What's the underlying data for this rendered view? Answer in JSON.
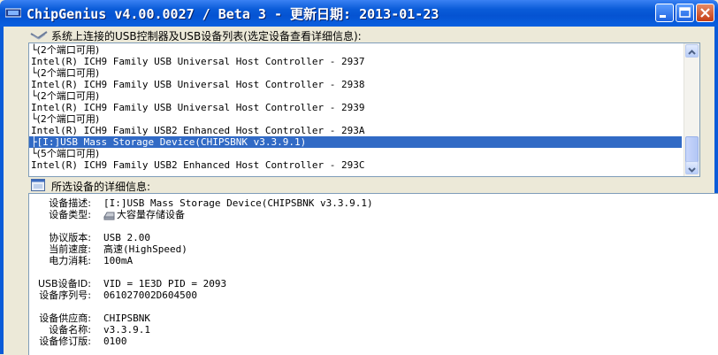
{
  "window": {
    "title": "ChipGenius v4.00.0027 / Beta 3 - 更新日期: 2013-01-23"
  },
  "device_list": {
    "label": "系统上连接的USB控制器及USB设备列表(选定设备查看详细信息):",
    "rows": [
      {
        "text": "└(2个端口可用)",
        "kind": "sub"
      },
      {
        "text": "Intel(R) ICH9 Family USB Universal Host Controller - 2937",
        "kind": "controller"
      },
      {
        "text": "└(2个端口可用)",
        "kind": "sub"
      },
      {
        "text": "Intel(R) ICH9 Family USB Universal Host Controller - 2938",
        "kind": "controller"
      },
      {
        "text": "└(2个端口可用)",
        "kind": "sub"
      },
      {
        "text": "Intel(R) ICH9 Family USB Universal Host Controller - 2939",
        "kind": "controller"
      },
      {
        "text": "└(2个端口可用)",
        "kind": "sub"
      },
      {
        "text": "Intel(R) ICH9 Family USB2 Enhanced Host Controller - 293A",
        "kind": "controller"
      },
      {
        "text": "├[I:]USB Mass Storage Device(CHIPSBNK v3.3.9.1)",
        "kind": "device",
        "selected": true
      },
      {
        "text": "└(5个端口可用)",
        "kind": "sub"
      },
      {
        "text": "Intel(R) ICH9 Family USB2 Enhanced Host Controller - 293C",
        "kind": "controller"
      }
    ]
  },
  "details": {
    "label": "所选设备的详细信息:",
    "rows": [
      {
        "label": "设备描述:",
        "value": "[I:]USB Mass Storage Device(CHIPSBNK v3.3.9.1)"
      },
      {
        "label": "设备类型:",
        "value": "大容量存储设备",
        "icon": "storage-device-icon"
      },
      {
        "label": "",
        "value": ""
      },
      {
        "label": "协议版本:",
        "value": "USB 2.00"
      },
      {
        "label": "当前速度:",
        "value": "高速(HighSpeed)"
      },
      {
        "label": "电力消耗:",
        "value": "100mA"
      },
      {
        "label": "",
        "value": ""
      },
      {
        "label": "USB设备ID:",
        "value": "VID = 1E3D PID = 2093"
      },
      {
        "label": "设备序列号:",
        "value": "061027002D604500"
      },
      {
        "label": "",
        "value": ""
      },
      {
        "label": "设备供应商:",
        "value": "CHIPSBNK"
      },
      {
        "label": "设备名称:",
        "value": "v3.3.9.1"
      },
      {
        "label": "设备修订版:",
        "value": "0100"
      }
    ]
  },
  "colors": {
    "title_bar": "#0A5BD8",
    "selection": "#316AC5",
    "window_face": "#ECE9D8"
  },
  "icons": {
    "app": "chipgenius-app-icon",
    "list_section": "usb-list-icon",
    "detail_section": "details-window-icon",
    "minimize": "minimize-icon",
    "maximize": "maximize-icon",
    "close": "close-icon"
  }
}
